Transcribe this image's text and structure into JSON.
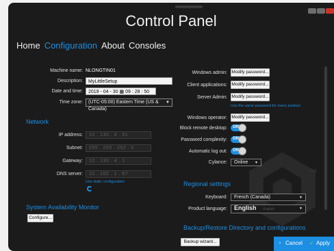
{
  "window": {
    "title": "Control Panel"
  },
  "nav": {
    "items": [
      {
        "label": "Home"
      },
      {
        "label": "Configuration",
        "active": true
      },
      {
        "label": "About"
      },
      {
        "label": "Consoles"
      }
    ]
  },
  "general": {
    "machine_name_label": "Machine name:",
    "machine_name_value": "NLONGTIN01",
    "description_label": "Description:",
    "description_value": "MyLittleSetup",
    "datetime_label": "Date and time:",
    "datetime_value": "2019 - 04 - 30  ▦  09 : 28 : 50 AM  ⏺",
    "timezone_label": "Time zone:",
    "timezone_value": "(UTC-05:00) Eastern Time (US & Canada)"
  },
  "network": {
    "header": "Network",
    "ip_label": "IP address:",
    "ip_value": "10 . 130 . 4 . 61",
    "subnet_label": "Subnet:",
    "subnet_value": "255 . 255 . 252 . 0",
    "gateway_label": "Gateway:",
    "gateway_value": "10 . 130 . 4 . 1",
    "dns_label": "DNS server:",
    "dns_value": "10 . 100 . 1 . 67",
    "static_link": "Use static configuration"
  },
  "availability": {
    "header": "System Availability Monitor",
    "configure_button": "Configure..."
  },
  "security": {
    "windows_admin_label": "Windows admin:",
    "client_apps_label": "Client applications:",
    "server_admin_label": "Server Admin:",
    "modify_password": "Modify password...",
    "same_password_link": "Use the same password for every product",
    "windows_operator_label": "Windows operator:",
    "block_remote_label": "Block remote desktop:",
    "password_complexity_label": "Password complexity:",
    "auto_logout_label": "Automatic log out:",
    "toggle_on": "ON",
    "cylance_label": "Cylance:",
    "cylance_value": "Online"
  },
  "regional": {
    "header": "Regional settings",
    "keyboard_label": "Keyboard:",
    "keyboard_value": "French (Canada)",
    "product_language_label": "Product language:",
    "product_language_value": "English",
    "product_language_sub": "English"
  },
  "backup": {
    "header": "Backup/Restore Directory and configurations",
    "backup_button": "Backup wizard..."
  },
  "footer": {
    "cancel_label": "Cancel",
    "apply_label": "Apply"
  },
  "watermark": {
    "tm": "TM"
  },
  "colors": {
    "accent": "#1c8fe3",
    "background": "#1b1b1b"
  }
}
